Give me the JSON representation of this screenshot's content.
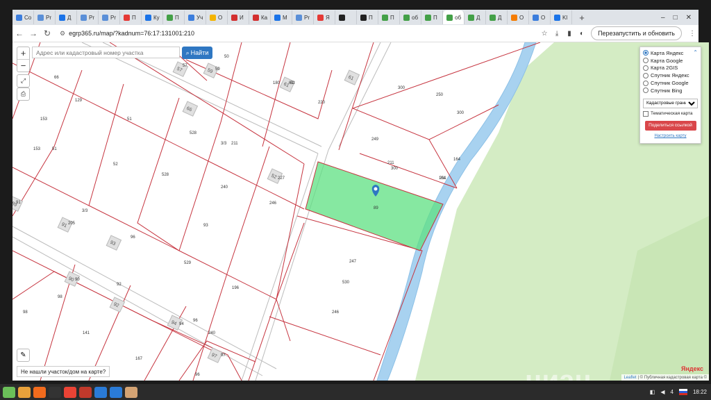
{
  "browser": {
    "tabs": [
      {
        "label": "Со",
        "color": "#3b7ddd"
      },
      {
        "label": "Pr",
        "color": "#5a8fd8"
      },
      {
        "label": "Д",
        "color": "#1a73e8"
      },
      {
        "label": "Pr",
        "color": "#5a8fd8"
      },
      {
        "label": "Pr",
        "color": "#5a8fd8"
      },
      {
        "label": "П",
        "color": "#e53935"
      },
      {
        "label": "Ку",
        "color": "#1a73e8"
      },
      {
        "label": "П",
        "color": "#43a047"
      },
      {
        "label": "Уч",
        "color": "#3b7ddd"
      },
      {
        "label": "О",
        "color": "#f4b400"
      },
      {
        "label": "И",
        "color": "#d32f2f"
      },
      {
        "label": "Ка",
        "color": "#d32f2f"
      },
      {
        "label": "М",
        "color": "#1a73e8"
      },
      {
        "label": "Pr",
        "color": "#5a8fd8"
      },
      {
        "label": "Я",
        "color": "#e53935"
      },
      {
        "label": "",
        "color": "#222"
      },
      {
        "label": "П",
        "color": "#222"
      },
      {
        "label": "П",
        "color": "#43a047"
      },
      {
        "label": "об",
        "color": "#43a047"
      },
      {
        "label": "П",
        "color": "#43a047"
      },
      {
        "label": "об",
        "color": "#43a047"
      },
      {
        "label": "Д",
        "color": "#43a047"
      },
      {
        "label": "Д",
        "color": "#43a047"
      },
      {
        "label": "О",
        "color": "#f57c00"
      },
      {
        "label": "О",
        "color": "#3b7ddd"
      },
      {
        "label": "Kl",
        "color": "#1a73e8"
      }
    ],
    "active_tab_index": 20,
    "new_tab": "+",
    "window_controls": {
      "minimize": "–",
      "maximize": "□",
      "close": "✕"
    },
    "back": "←",
    "forward": "→",
    "reload": "↻",
    "site_icon": "⚙",
    "url": "egrp365.ru/map/?kadnum=76:17:131001:210",
    "relaunch_label": "Перезапустить и обновить",
    "menu": "⋮"
  },
  "map": {
    "search_placeholder": "Адрес или кадастровый номер участка",
    "find_label": "Найти",
    "zoom_in": "+",
    "zoom_out": "−",
    "layers": {
      "options": [
        "Карта Яндекс",
        "Карта Google",
        "Карта 2GIS",
        "Спутник Яндекс",
        "Спутник Google",
        "Спутник Bing"
      ],
      "selected": 0,
      "overlay_select": "Кадастровые границы",
      "thematic": "Тематическая карта",
      "share": "Поделиться ссылкой",
      "setup": "Настроить карту"
    },
    "not_found": "Не нашли участок/дом на карте?",
    "attribution_leaflet": "Leaflet",
    "attribution_rest": "| © Публичная кадастровая карта ©",
    "yandex_logo": "Яндекс",
    "watermark": "циан",
    "parcel_labels": [
      "57",
      "50",
      "59",
      "61",
      "180",
      "61",
      "220",
      "300",
      "250",
      "300",
      "129",
      "153",
      "66",
      "51",
      "528",
      "3/3",
      "211",
      "249",
      "211",
      "300",
      "164",
      "164",
      "153",
      "51",
      "52",
      "528",
      "227",
      "240",
      "246",
      "89",
      "91",
      "205",
      "3/3",
      "93",
      "96",
      "529",
      "247",
      "530",
      "90",
      "98",
      "92",
      "196",
      "96",
      "98",
      "141",
      "94",
      "240",
      "246",
      "167",
      "97",
      "96",
      "211"
    ],
    "house_numbers": [
      "57",
      "59",
      "61",
      "61",
      "66",
      "52",
      "89",
      "91",
      "93",
      "90",
      "92",
      "94",
      "97"
    ]
  },
  "taskbar": {
    "apps": [
      {
        "name": "menu",
        "color": "#6bbf59"
      },
      {
        "name": "files",
        "color": "#e9a23b"
      },
      {
        "name": "firefox",
        "color": "#f26b1d"
      },
      {
        "name": "terminal",
        "color": "#333"
      },
      {
        "name": "chrome",
        "color": "#ea4335"
      },
      {
        "name": "shop",
        "color": "#c0392b"
      },
      {
        "name": "camera",
        "color": "#2a7bd7"
      },
      {
        "name": "notes",
        "color": "#2a7bd7"
      },
      {
        "name": "box",
        "color": "#d4a373"
      }
    ],
    "tray_count": "4",
    "time": "18:22"
  }
}
